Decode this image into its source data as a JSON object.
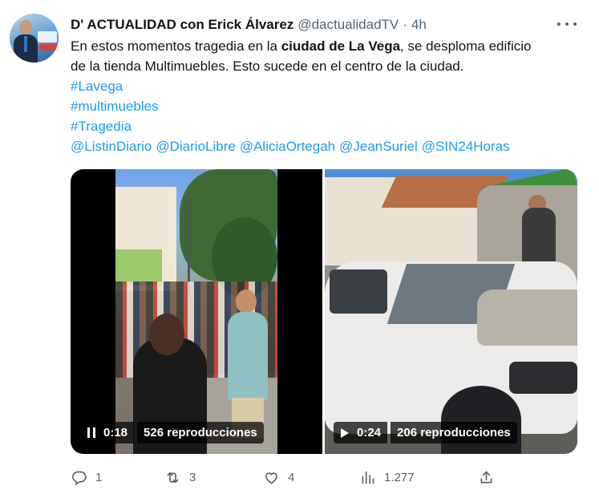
{
  "tweet": {
    "author_name": "D' ACTUALIDAD con Erick Álvarez",
    "handle": "@dactualidadTV",
    "separator": "·",
    "time": "4h",
    "text": {
      "part1": "En estos momentos tragedia en la ",
      "bold": "ciudad de La Vega",
      "part2": ", se desploma edificio",
      "line2": "de la tienda Multimuebles. Esto sucede en el centro de la ciudad."
    },
    "hashtags": [
      "#Lavega",
      "#multimuebles",
      "#Tragedia"
    ],
    "mentions": [
      "@ListinDiario",
      "@DiarioLibre",
      "@AliciaOrtegah",
      "@JeanSuriel",
      "@SIN24Horas"
    ]
  },
  "media": {
    "videos": [
      {
        "state": "pause-icon",
        "time": "0:18",
        "views": "526 reproducciones"
      },
      {
        "state": "play-icon",
        "time": "0:24",
        "views": "206 reproducciones"
      }
    ]
  },
  "actions": {
    "reply_count": "1",
    "retweet_count": "3",
    "like_count": "4",
    "views_count": "1.277"
  },
  "colors": {
    "text": "#0f1419",
    "secondary": "#536471",
    "link": "#1d9bf0"
  }
}
